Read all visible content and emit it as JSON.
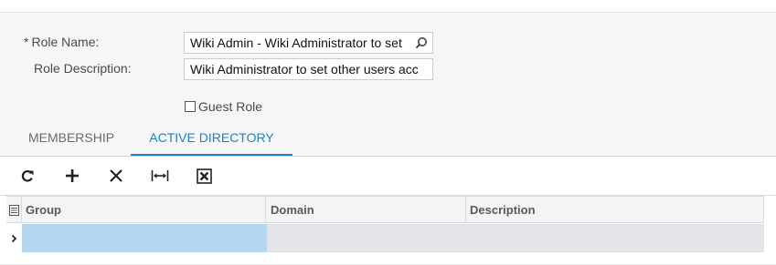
{
  "form": {
    "role_name_label": "Role Name:",
    "required_mark": "*",
    "role_name_value": "Wiki Admin - Wiki Administrator to set",
    "role_description_label": "Role Description:",
    "role_description_value": "Wiki Administrator to set other users acc",
    "guest_role_label": "Guest Role",
    "guest_role_checked": false
  },
  "tabs": [
    {
      "label": "MEMBERSHIP",
      "active": false
    },
    {
      "label": "ACTIVE DIRECTORY",
      "active": true
    }
  ],
  "toolbar": {
    "buttons": [
      "refresh-icon",
      "add-icon",
      "delete-icon",
      "fit-columns-icon",
      "export-excel-icon"
    ]
  },
  "grid": {
    "columns": [
      "Group",
      "Domain",
      "Description"
    ],
    "rows": [
      {
        "group": "",
        "domain": "",
        "description": ""
      }
    ]
  },
  "colors": {
    "accent": "#1d82c8",
    "selected_cell": "#b4d7f0",
    "form_background": "#f5f6f7"
  }
}
